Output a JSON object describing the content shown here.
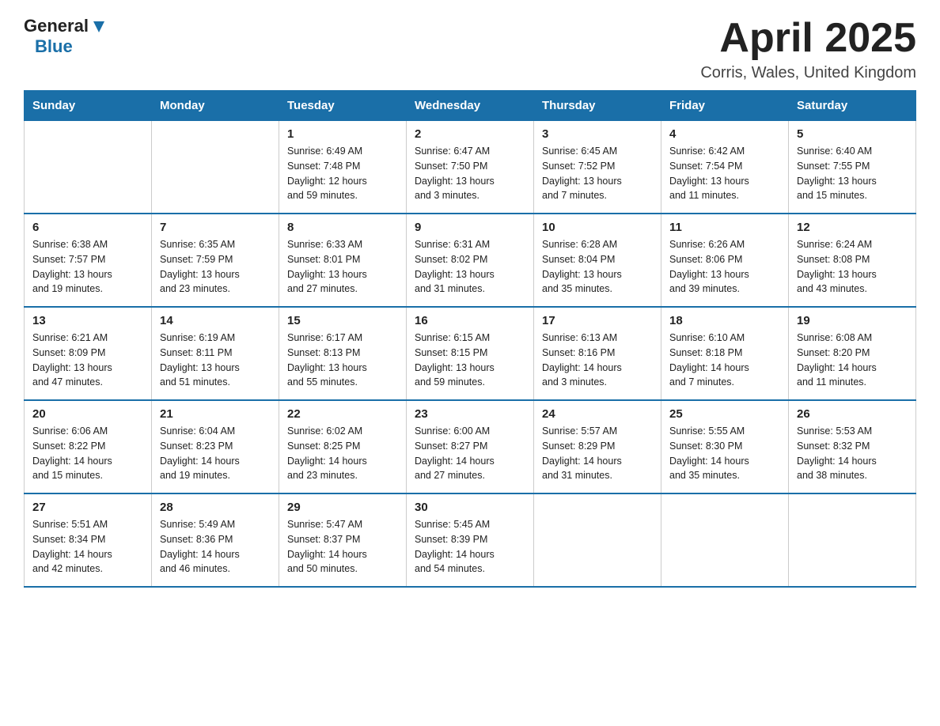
{
  "header": {
    "logo_line1": "General",
    "logo_line2": "Blue",
    "month": "April 2025",
    "location": "Corris, Wales, United Kingdom"
  },
  "weekdays": [
    "Sunday",
    "Monday",
    "Tuesday",
    "Wednesday",
    "Thursday",
    "Friday",
    "Saturday"
  ],
  "weeks": [
    [
      {
        "day": "",
        "info": ""
      },
      {
        "day": "",
        "info": ""
      },
      {
        "day": "1",
        "info": "Sunrise: 6:49 AM\nSunset: 7:48 PM\nDaylight: 12 hours\nand 59 minutes."
      },
      {
        "day": "2",
        "info": "Sunrise: 6:47 AM\nSunset: 7:50 PM\nDaylight: 13 hours\nand 3 minutes."
      },
      {
        "day": "3",
        "info": "Sunrise: 6:45 AM\nSunset: 7:52 PM\nDaylight: 13 hours\nand 7 minutes."
      },
      {
        "day": "4",
        "info": "Sunrise: 6:42 AM\nSunset: 7:54 PM\nDaylight: 13 hours\nand 11 minutes."
      },
      {
        "day": "5",
        "info": "Sunrise: 6:40 AM\nSunset: 7:55 PM\nDaylight: 13 hours\nand 15 minutes."
      }
    ],
    [
      {
        "day": "6",
        "info": "Sunrise: 6:38 AM\nSunset: 7:57 PM\nDaylight: 13 hours\nand 19 minutes."
      },
      {
        "day": "7",
        "info": "Sunrise: 6:35 AM\nSunset: 7:59 PM\nDaylight: 13 hours\nand 23 minutes."
      },
      {
        "day": "8",
        "info": "Sunrise: 6:33 AM\nSunset: 8:01 PM\nDaylight: 13 hours\nand 27 minutes."
      },
      {
        "day": "9",
        "info": "Sunrise: 6:31 AM\nSunset: 8:02 PM\nDaylight: 13 hours\nand 31 minutes."
      },
      {
        "day": "10",
        "info": "Sunrise: 6:28 AM\nSunset: 8:04 PM\nDaylight: 13 hours\nand 35 minutes."
      },
      {
        "day": "11",
        "info": "Sunrise: 6:26 AM\nSunset: 8:06 PM\nDaylight: 13 hours\nand 39 minutes."
      },
      {
        "day": "12",
        "info": "Sunrise: 6:24 AM\nSunset: 8:08 PM\nDaylight: 13 hours\nand 43 minutes."
      }
    ],
    [
      {
        "day": "13",
        "info": "Sunrise: 6:21 AM\nSunset: 8:09 PM\nDaylight: 13 hours\nand 47 minutes."
      },
      {
        "day": "14",
        "info": "Sunrise: 6:19 AM\nSunset: 8:11 PM\nDaylight: 13 hours\nand 51 minutes."
      },
      {
        "day": "15",
        "info": "Sunrise: 6:17 AM\nSunset: 8:13 PM\nDaylight: 13 hours\nand 55 minutes."
      },
      {
        "day": "16",
        "info": "Sunrise: 6:15 AM\nSunset: 8:15 PM\nDaylight: 13 hours\nand 59 minutes."
      },
      {
        "day": "17",
        "info": "Sunrise: 6:13 AM\nSunset: 8:16 PM\nDaylight: 14 hours\nand 3 minutes."
      },
      {
        "day": "18",
        "info": "Sunrise: 6:10 AM\nSunset: 8:18 PM\nDaylight: 14 hours\nand 7 minutes."
      },
      {
        "day": "19",
        "info": "Sunrise: 6:08 AM\nSunset: 8:20 PM\nDaylight: 14 hours\nand 11 minutes."
      }
    ],
    [
      {
        "day": "20",
        "info": "Sunrise: 6:06 AM\nSunset: 8:22 PM\nDaylight: 14 hours\nand 15 minutes."
      },
      {
        "day": "21",
        "info": "Sunrise: 6:04 AM\nSunset: 8:23 PM\nDaylight: 14 hours\nand 19 minutes."
      },
      {
        "day": "22",
        "info": "Sunrise: 6:02 AM\nSunset: 8:25 PM\nDaylight: 14 hours\nand 23 minutes."
      },
      {
        "day": "23",
        "info": "Sunrise: 6:00 AM\nSunset: 8:27 PM\nDaylight: 14 hours\nand 27 minutes."
      },
      {
        "day": "24",
        "info": "Sunrise: 5:57 AM\nSunset: 8:29 PM\nDaylight: 14 hours\nand 31 minutes."
      },
      {
        "day": "25",
        "info": "Sunrise: 5:55 AM\nSunset: 8:30 PM\nDaylight: 14 hours\nand 35 minutes."
      },
      {
        "day": "26",
        "info": "Sunrise: 5:53 AM\nSunset: 8:32 PM\nDaylight: 14 hours\nand 38 minutes."
      }
    ],
    [
      {
        "day": "27",
        "info": "Sunrise: 5:51 AM\nSunset: 8:34 PM\nDaylight: 14 hours\nand 42 minutes."
      },
      {
        "day": "28",
        "info": "Sunrise: 5:49 AM\nSunset: 8:36 PM\nDaylight: 14 hours\nand 46 minutes."
      },
      {
        "day": "29",
        "info": "Sunrise: 5:47 AM\nSunset: 8:37 PM\nDaylight: 14 hours\nand 50 minutes."
      },
      {
        "day": "30",
        "info": "Sunrise: 5:45 AM\nSunset: 8:39 PM\nDaylight: 14 hours\nand 54 minutes."
      },
      {
        "day": "",
        "info": ""
      },
      {
        "day": "",
        "info": ""
      },
      {
        "day": "",
        "info": ""
      }
    ]
  ]
}
